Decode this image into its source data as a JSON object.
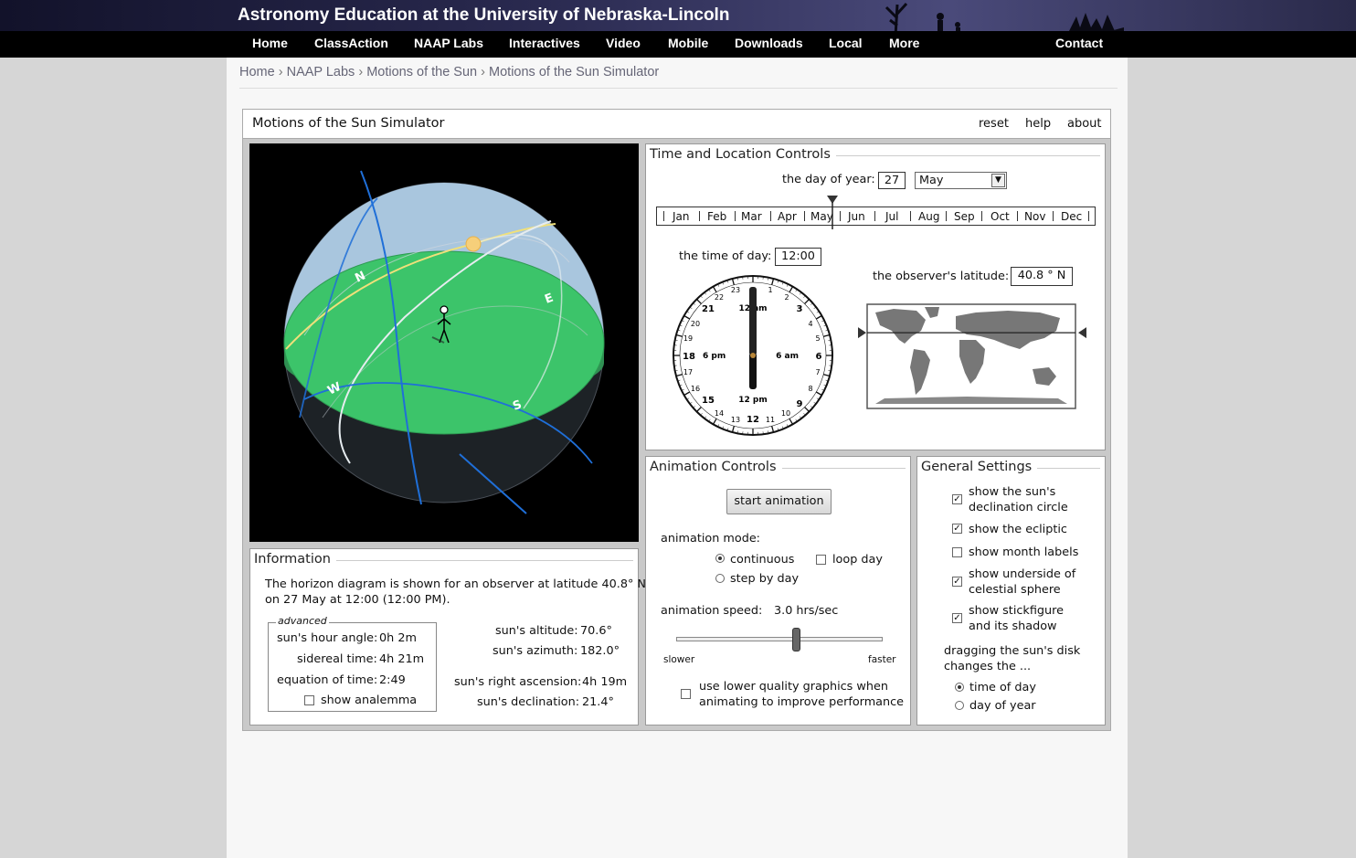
{
  "header": {
    "site_title": "Astronomy Education at the University of Nebraska-Lincoln",
    "nav": [
      "Home",
      "ClassAction",
      "NAAP Labs",
      "Interactives",
      "Video",
      "Mobile",
      "Downloads",
      "Local",
      "More",
      "Contact"
    ]
  },
  "breadcrumb": {
    "items": [
      "Home",
      "NAAP Labs",
      "Motions of the Sun",
      "Motions of the Sun Simulator"
    ],
    "separator": "›"
  },
  "app": {
    "title": "Motions of the Sun Simulator",
    "links": [
      "reset",
      "help",
      "about"
    ]
  },
  "sphere": {
    "directions": {
      "north": "N",
      "east": "E",
      "south": "S",
      "west": "W"
    },
    "colors": {
      "horizon": "#3cc46a",
      "sky": "#a9c6de",
      "ecliptic": "#f0e07a",
      "axis": "#1f6fd8",
      "sun": "#f6cf7a"
    }
  },
  "time_location": {
    "legend": "Time and Location Controls",
    "day_label": "the day of year:",
    "day_value": "27",
    "month_selected": "May",
    "months": [
      "Jan",
      "Feb",
      "Mar",
      "Apr",
      "May",
      "Jun",
      "Jul",
      "Aug",
      "Sep",
      "Oct",
      "Nov",
      "Dec"
    ],
    "day_fraction": 0.4,
    "time_label": "the time of day:",
    "time_value": "12:00",
    "latitude_label": "the observer's latitude:",
    "latitude_value": "40.8 ° N",
    "latitude_deg": 40.8,
    "clock": {
      "major": [
        "12",
        "3",
        "6",
        "9",
        "12",
        "15",
        "18",
        "21"
      ],
      "minor": [
        "1",
        "2",
        "4",
        "5",
        "7",
        "8",
        "10",
        "11",
        "13",
        "14",
        "16",
        "17",
        "19",
        "20",
        "22",
        "23"
      ],
      "inner": {
        "top": "12 am",
        "right": "6 am",
        "bottom": "12 pm",
        "left": "6 pm"
      }
    }
  },
  "animation": {
    "legend": "Animation Controls",
    "start_button": "start animation",
    "mode_label": "animation mode:",
    "mode_continuous": "continuous",
    "mode_step": "step by day",
    "loop_day": "loop day",
    "speed_label": "animation speed:",
    "speed_value": "3.0 hrs/sec",
    "speed_fraction": 0.58,
    "slower": "slower",
    "faster": "faster",
    "lower_quality_1": "use lower quality graphics when",
    "lower_quality_2": "animating to improve performance"
  },
  "settings": {
    "legend": "General Settings",
    "decl_1": "show the sun's",
    "decl_2": "declination circle",
    "ecliptic": "show the ecliptic",
    "month_labels": "show month labels",
    "underside_1": "show underside of",
    "underside_2": "celestial sphere",
    "stick_1": "show stickfigure",
    "stick_2": "and its shadow",
    "drag_1": "dragging the sun's disk",
    "drag_2": "changes the ...",
    "drag_time": "time of day",
    "drag_year": "day of year"
  },
  "info": {
    "legend": "Information",
    "line1": "The horizon diagram is shown for an observer at latitude 40.8° N",
    "line2": "on 27 May at 12:00 (12:00 PM).",
    "advanced": "advanced",
    "hour_angle_label": "sun's hour angle:",
    "hour_angle_value": "0h 2m",
    "sidereal_label": "sidereal time:",
    "sidereal_value": "4h 21m",
    "eot_label": "equation of time:",
    "eot_value": "2:49",
    "analemma": "show analemma",
    "altitude_label": "sun's altitude:",
    "altitude_value": "70.6°",
    "azimuth_label": "sun's azimuth:",
    "azimuth_value": "182.0°",
    "ra_label": "sun's right ascension:",
    "ra_value": "4h 19m",
    "dec_label": "sun's declination:",
    "dec_value": "21.4°"
  }
}
